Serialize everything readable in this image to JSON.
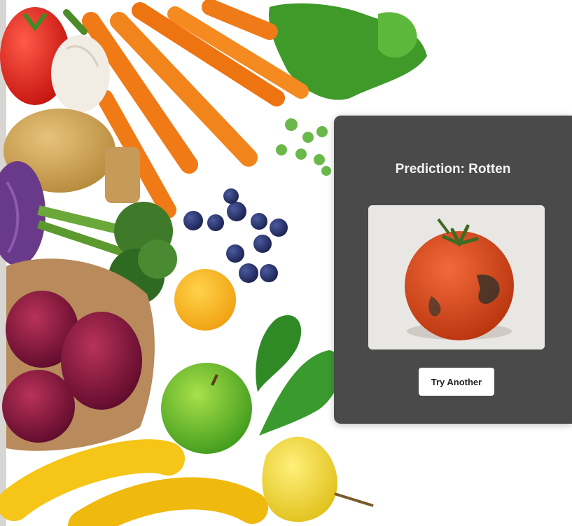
{
  "result": {
    "title": "Prediction: Rotten",
    "button_label": "Try Another"
  }
}
